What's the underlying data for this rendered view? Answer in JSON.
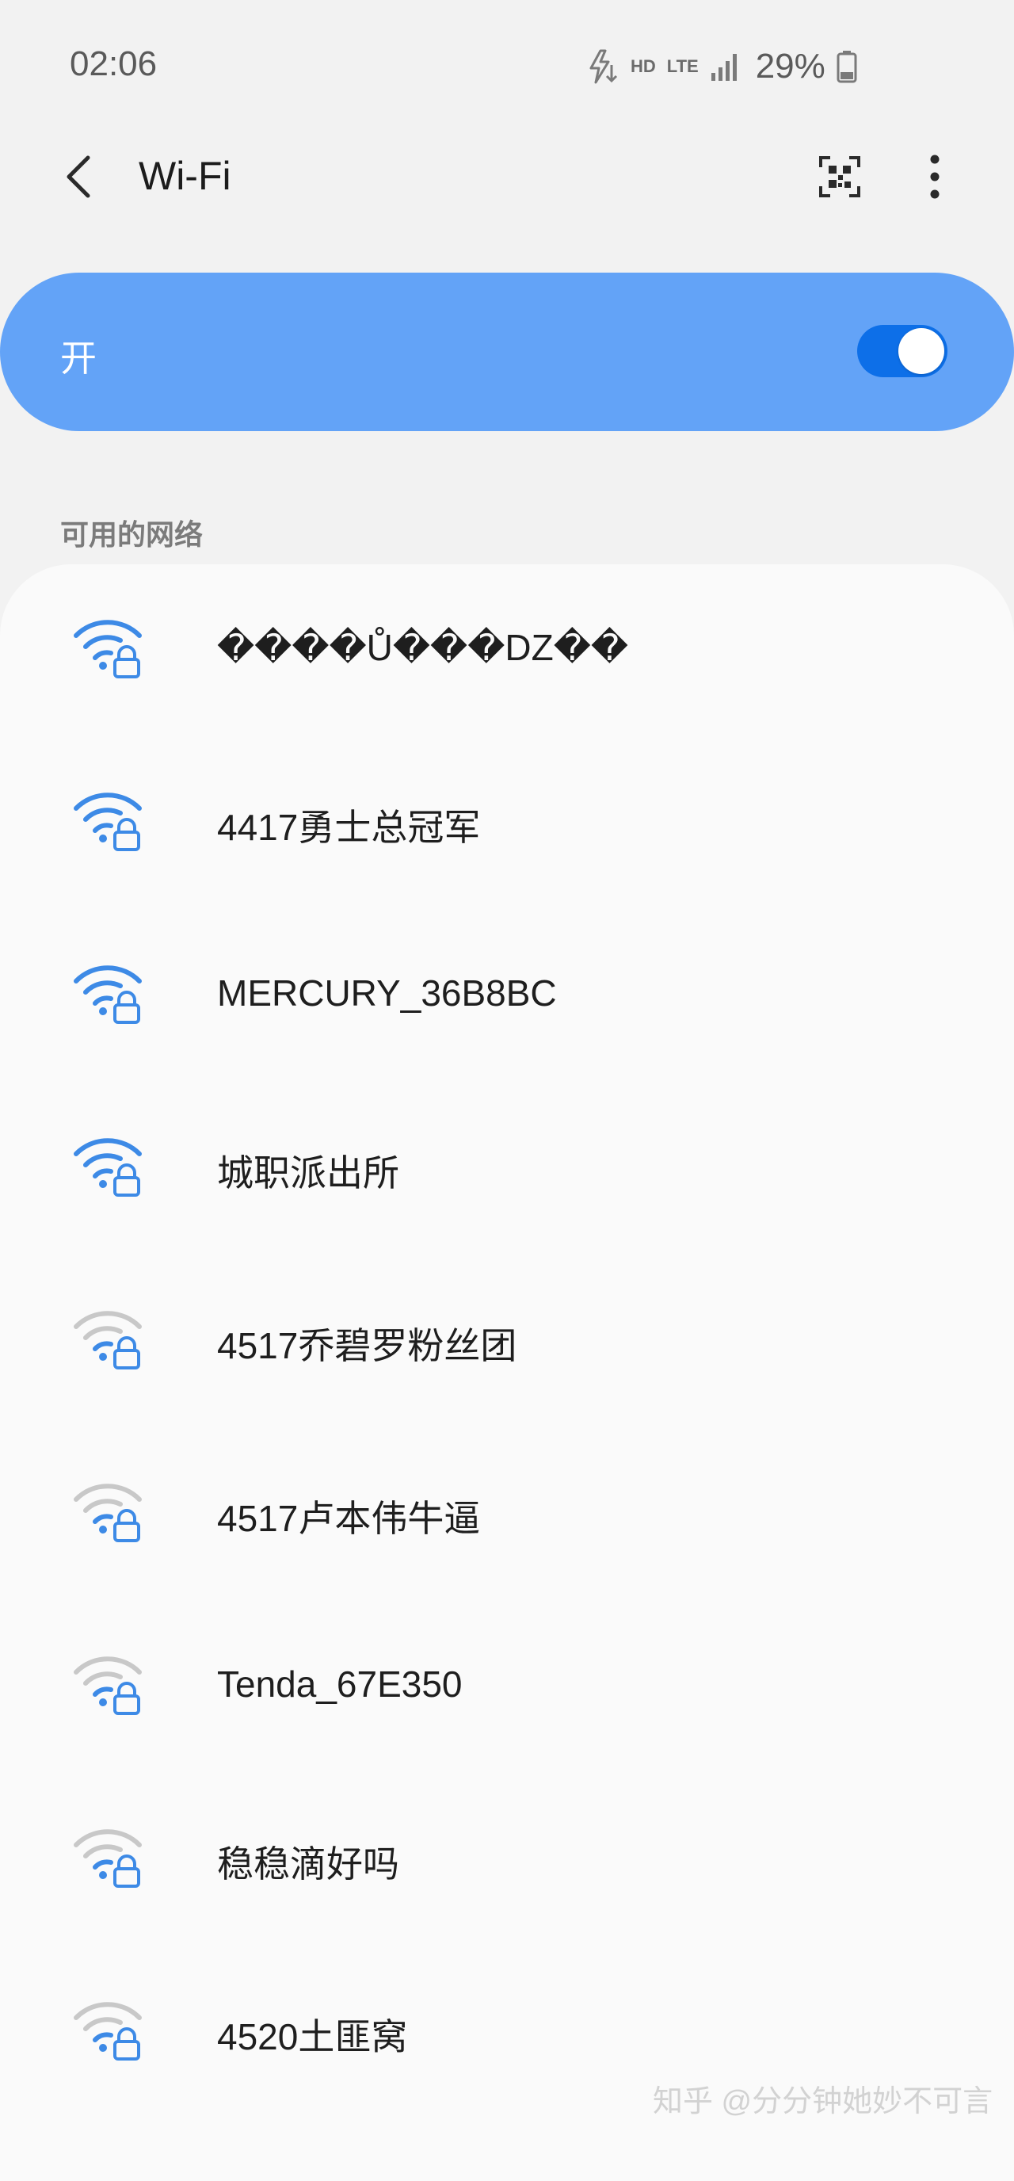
{
  "status_bar": {
    "time": "02:06",
    "hd_label": "HD",
    "lte_label": "LTE",
    "battery_percent": "29%",
    "icons": [
      "charging-bolt-icon",
      "signal-icon",
      "battery-icon"
    ]
  },
  "header": {
    "title": "Wi-Fi",
    "back_icon": "back-arrow-icon",
    "qr_icon": "qr-scan-icon",
    "more_icon": "more-vertical-icon"
  },
  "wifi_toggle": {
    "label": "开",
    "enabled": true
  },
  "available_networks": {
    "section_title": "可用的网络",
    "networks": [
      {
        "name": "����Ů���DZ��",
        "signal": "strong",
        "secured": true
      },
      {
        "name": "4417勇士总冠军",
        "signal": "strong",
        "secured": true
      },
      {
        "name": "MERCURY_36B8BC",
        "signal": "strong",
        "secured": true
      },
      {
        "name": "城职派出所",
        "signal": "strong",
        "secured": true
      },
      {
        "name": "4517乔碧罗粉丝团",
        "signal": "weak",
        "secured": true
      },
      {
        "name": "4517卢本伟牛逼",
        "signal": "weak",
        "secured": true
      },
      {
        "name": "Tenda_67E350",
        "signal": "weak",
        "secured": true
      },
      {
        "name": "稳稳滴好吗",
        "signal": "weak",
        "secured": true
      },
      {
        "name": "4520土匪窝",
        "signal": "weak",
        "secured": true
      }
    ]
  },
  "watermark": "知乎 @分分钟她妙不可言",
  "colors": {
    "accent": "#0d6fe8",
    "toggle_bar": "#63a3f7",
    "wifi_strong": "#3d8ae6",
    "wifi_weak_arc": "#c8c8c8"
  }
}
